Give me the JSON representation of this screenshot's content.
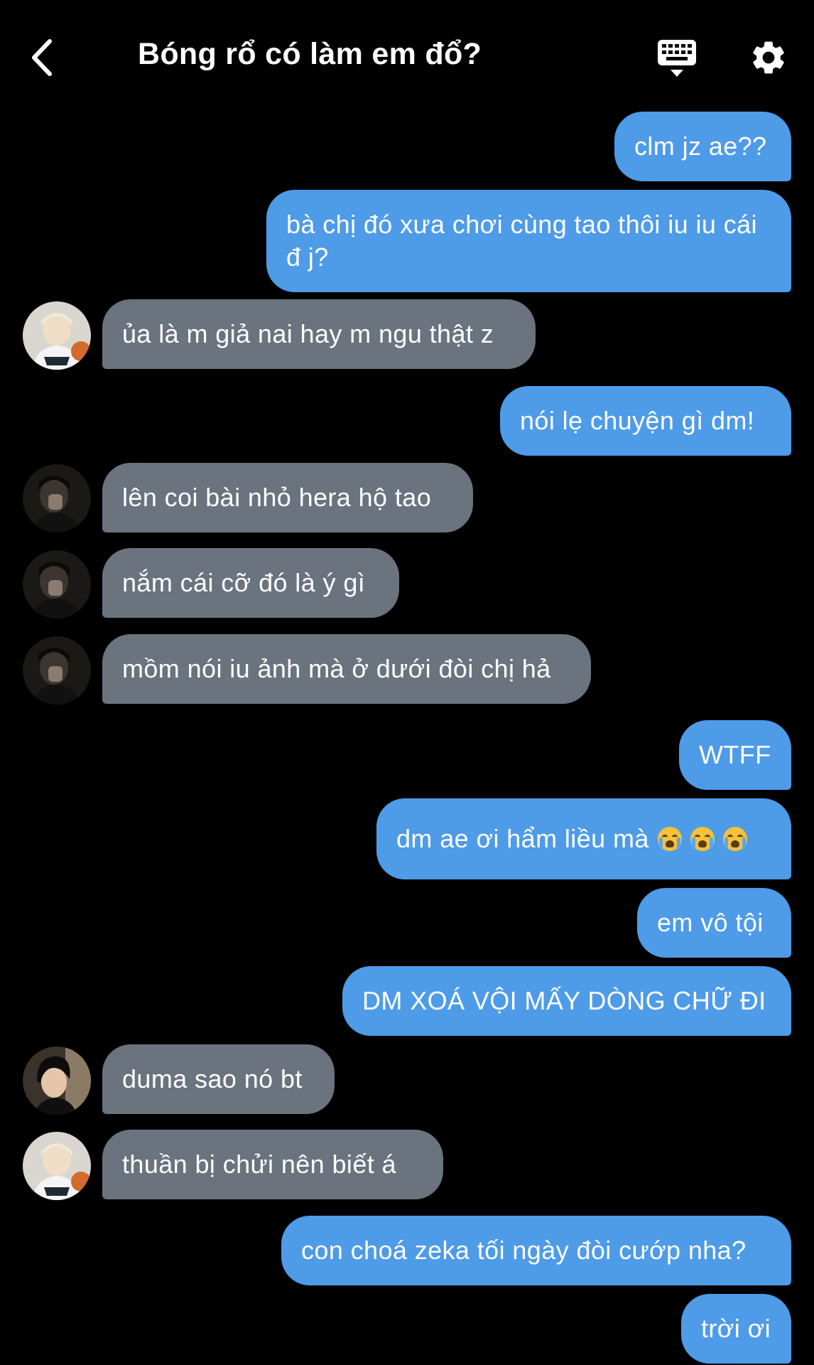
{
  "header": {
    "title": "Bóng rổ có làm em đổ?",
    "back_icon": "chevron-left-icon",
    "keyboard_icon": "keyboard-icon",
    "settings_icon": "gear-icon"
  },
  "colors": {
    "background": "#000000",
    "outgoing_bubble": "#4e9be8",
    "incoming_bubble": "#6a737e",
    "text": "#ffffff"
  },
  "messages": [
    {
      "side": "out",
      "text": "clm jz ae??"
    },
    {
      "side": "out",
      "text": "bà chị đó xưa chơi cùng tao thôi iu iu cái đ j?"
    },
    {
      "side": "in",
      "avatar": "avatar-blonde",
      "text": "ủa là m giả nai hay m ngu thật z"
    },
    {
      "side": "out",
      "text": "nói lẹ chuyện gì dm!"
    },
    {
      "side": "in",
      "avatar": "avatar-dark",
      "text": "lên coi bài nhỏ hera hộ tao"
    },
    {
      "side": "in",
      "avatar": "avatar-dark",
      "text": "nắm cái cỡ đó là ý gì"
    },
    {
      "side": "in",
      "avatar": "avatar-dark",
      "text": "mồm nói iu ảnh mà ở dưới đòi chị hả"
    },
    {
      "side": "out",
      "text": "WTFF"
    },
    {
      "side": "out",
      "text": "dm ae ơi hẩm liều mà",
      "emoji": "loudly-crying-face-icon",
      "emoji_count": 3
    },
    {
      "side": "out",
      "text": "em vô tội"
    },
    {
      "side": "out",
      "text": "DM XOÁ VỘI MẤY DÒNG CHỮ ĐI"
    },
    {
      "side": "in",
      "avatar": "avatar-black-hair",
      "text": "duma sao nó bt"
    },
    {
      "side": "in",
      "avatar": "avatar-blonde",
      "text": "thuần bị chửi nên biết á"
    },
    {
      "side": "out",
      "text": "con choá zeka tối ngày đòi cướp nha?"
    },
    {
      "side": "out",
      "text": "trời ơi"
    }
  ]
}
